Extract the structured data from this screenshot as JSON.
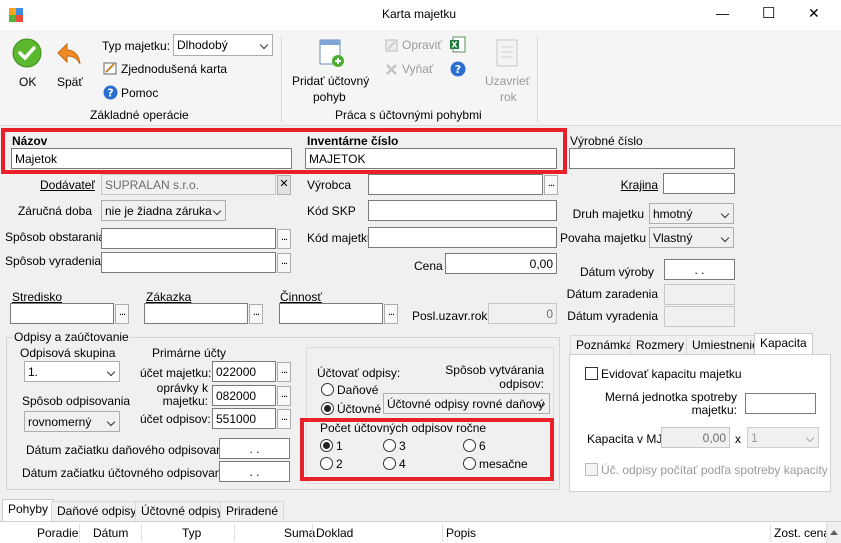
{
  "window": {
    "title": "Karta majetku",
    "min": "—",
    "max": "☐",
    "close": "✕"
  },
  "toolbar": {
    "ok": "OK",
    "back": "Späť",
    "asset_type_label": "Typ majetku:",
    "asset_type_value": "Dlhodobý",
    "simple_card": "Zjednodušená karta",
    "help": "Pomoc",
    "group_basic": "Základné operácie",
    "add_move_1": "Pridať účtovný",
    "add_move_2": "pohyb",
    "edit": "Opraviť",
    "remove": "Vyňať",
    "close_year_1": "Uzavrieť",
    "close_year_2": "rok",
    "group_moves": "Práca s účtovnými pohybmi"
  },
  "form": {
    "name_label": "Názov",
    "name_value": "Majetok",
    "inv_label": "Inventárne číslo",
    "inv_value": "MAJETOK",
    "serial_label": "Výrobné číslo",
    "serial_value": "",
    "supplier_label": "Dodávateľ",
    "supplier_value": "SUPRALAN s.r.o.",
    "warranty_label": "Záručná doba",
    "warranty_value": "nie je žiadna záruka",
    "acq_label": "Spôsob obstarania",
    "acq_value": "",
    "disp_label": "Spôsob vyradenia",
    "disp_value": "",
    "maker_label": "Výrobca",
    "maker_value": "",
    "skp_label": "Kód SKP",
    "skp_value": "",
    "code_label": "Kód majetku",
    "code_value": "",
    "price_label": "Cena",
    "price_value": "0,00",
    "country_label": "Krajina",
    "country_value": "",
    "kind_label": "Druh majetku",
    "kind_value": "hmotný",
    "nature_label": "Povaha majetku",
    "nature_value": "Vlastný",
    "prod_date_label": "Dátum výroby",
    "prod_date_value": ". .",
    "incl_date_label": "Dátum zaradenia",
    "incl_date_value": "",
    "disp_date_label": "Dátum vyradenia",
    "disp_date_value": "",
    "center_label": "Stredisko",
    "order_label": "Zákazka",
    "activity_label": "Činnosť",
    "last_year_label": "Posl.uzavr.rok",
    "last_year_value": "0"
  },
  "depr": {
    "group_title": "Odpisy a zaúčtovanie",
    "group_label": "Odpisová skupina",
    "group_value": "1.",
    "method_label": "Spôsob odpisovania",
    "method_value": "rovnomerný",
    "primary_label": "Primárne účty",
    "acc_asset_label": "účet majetku:",
    "acc_asset_value": "022000",
    "acc_adj_label_1": "oprávky k",
    "acc_adj_label_2": "majetku:",
    "acc_adj_value": "082000",
    "acc_depr_label": "účet odpisov:",
    "acc_depr_value": "551000",
    "tax_start_label": "Dátum začiatku daňového odpisovania:",
    "tax_start_value": ". .",
    "acc_start_label": "Dátum začiatku účtovného odpisovania:",
    "acc_start_value": ". .",
    "post_label": "Účtovať odpisy:",
    "post_tax": "Daňové",
    "post_acc": "Účtovné",
    "create_label_1": "Spôsob vytvárania",
    "create_label_2": "odpisov:",
    "create_value": "Účtovné odpisy rovné daňový",
    "count_label": "Počet účtovných odpisov ročne",
    "opt_1": "1",
    "opt_2": "2",
    "opt_3": "3",
    "opt_4": "4",
    "opt_6": "6",
    "opt_m": "mesačne"
  },
  "right_tabs": [
    "Poznámka",
    "Rozmery",
    "Umiestnenie",
    "Kapacita"
  ],
  "capacity": {
    "eval_label": "Evidovať kapacitu majetku",
    "unit_label_1": "Merná jednotka spotreby",
    "unit_label_2": "majetku:",
    "unit_value": "",
    "cap_label": "Kapacita v MJ:",
    "cap_value": "0,00",
    "x": "x",
    "mult_value": "1",
    "acc_label": "Úč. odpisy počítať podľa spotreby kapacity"
  },
  "bottom_tabs": [
    "Pohyby",
    "Daňové odpisy",
    "Účtovné odpisy",
    "Priradené"
  ],
  "grid_columns": [
    "Poradie",
    "Dátum",
    "Typ",
    "Suma",
    "Doklad",
    "Popis",
    "Zost. cena"
  ],
  "colors": {
    "highlight": "#e8202a",
    "accent": "#0078d7"
  }
}
